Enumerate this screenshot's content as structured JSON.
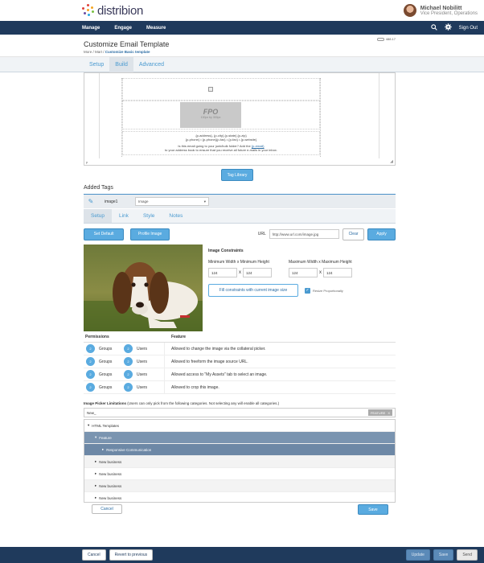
{
  "header": {
    "logo_text": "distribion",
    "user_name": "Michael Nobilitt",
    "user_role": "Vice President, Operations"
  },
  "nav": {
    "items": [
      "Manage",
      "Engage",
      "Measure"
    ],
    "sign_out": "Sign Out"
  },
  "page": {
    "title": "Customize Email Template",
    "crumb_1": "More / Mart /",
    "crumb_2": "Customize Basic template",
    "msg_count": "488.17"
  },
  "tabs": [
    "Setup",
    "Build",
    "Advanced"
  ],
  "active_tab": "Build",
  "editor": {
    "fpo_big": "FPO",
    "fpo_small": "100px by 300px",
    "footer_line1": "{p-address}, {p-city} {p-state} {p-zip}",
    "footer_line2": "{p-phone} • {p-phone}{p-fax} • {p-fax} • {p-website}",
    "footer_line3_a": "Is this email going to your junk/bulk folder? Add the",
    "footer_line3_link": "{p-email}",
    "footer_line4": "to your address book to ensure that you receive all future e-mails in your inbox.",
    "status": "p"
  },
  "tag_library_label": "Tag Library",
  "added_tags": {
    "title": "Added Tags",
    "tag_name": "image1",
    "tag_type": "Image"
  },
  "subtabs": [
    "Setup",
    "Link",
    "Style",
    "Notes"
  ],
  "actions": {
    "set_default": "Set Default",
    "profile_image": "Profile Image",
    "url_label": "URL",
    "url_value": "http://www.url.com/image.jpg",
    "clear": "Clear",
    "apply": "Apply"
  },
  "constraints": {
    "title": "Image Constraints",
    "min_label": "Minimum Width x Minimum Height",
    "max_label": "Maximum Width x Maximum Height",
    "min_w": "124",
    "min_h": "124",
    "max_w": "124",
    "max_h": "124",
    "x": "x",
    "fill_button": "Fill constraints with current image size",
    "resize_label": "Resize Proportionally"
  },
  "permissions": {
    "head_perm": "Permissions",
    "head_feature": "Feature",
    "rows": [
      {
        "groups": "2",
        "groups_label": "Groups",
        "users": "2",
        "users_label": "Users",
        "feature": "Allowed to change the image via the collateral picker."
      },
      {
        "groups": "2",
        "groups_label": "Groups",
        "users": "2",
        "users_label": "Users",
        "feature": "Allowed to freeform the image source URL."
      },
      {
        "groups": "2",
        "groups_label": "Groups",
        "users": "2",
        "users_label": "Users",
        "feature": "Allowed access to \"My Assets\" tab to select an image."
      },
      {
        "groups": "2",
        "groups_label": "Groups",
        "users": "2",
        "users_label": "Users",
        "feature": "Allowed to crop this image."
      }
    ]
  },
  "picker": {
    "title_bold": "Image Picker Limitations",
    "title_rest": " (Users can only pick from the following categories. Not selecting any will enable all categories.)",
    "search_value": "New_",
    "chip": "FEATURE",
    "chip_close": "X",
    "tree": [
      {
        "label": "HTML Templates",
        "indent": 0,
        "style": ""
      },
      {
        "label": "Feature",
        "indent": 1,
        "style": "sel1"
      },
      {
        "label": "Responsive Communication",
        "indent": 2,
        "style": "sel2"
      },
      {
        "label": "New business",
        "indent": 1,
        "style": "alt"
      },
      {
        "label": "New business",
        "indent": 1,
        "style": ""
      },
      {
        "label": "New business",
        "indent": 1,
        "style": "alt"
      },
      {
        "label": "New business",
        "indent": 1,
        "style": ""
      }
    ]
  },
  "form_buttons": {
    "cancel": "Cancel",
    "save": "Save"
  },
  "bottom_bar": {
    "cancel": "Cancel",
    "revert": "Revert to previous",
    "update": "Update",
    "save": "Save",
    "send": "Send"
  }
}
